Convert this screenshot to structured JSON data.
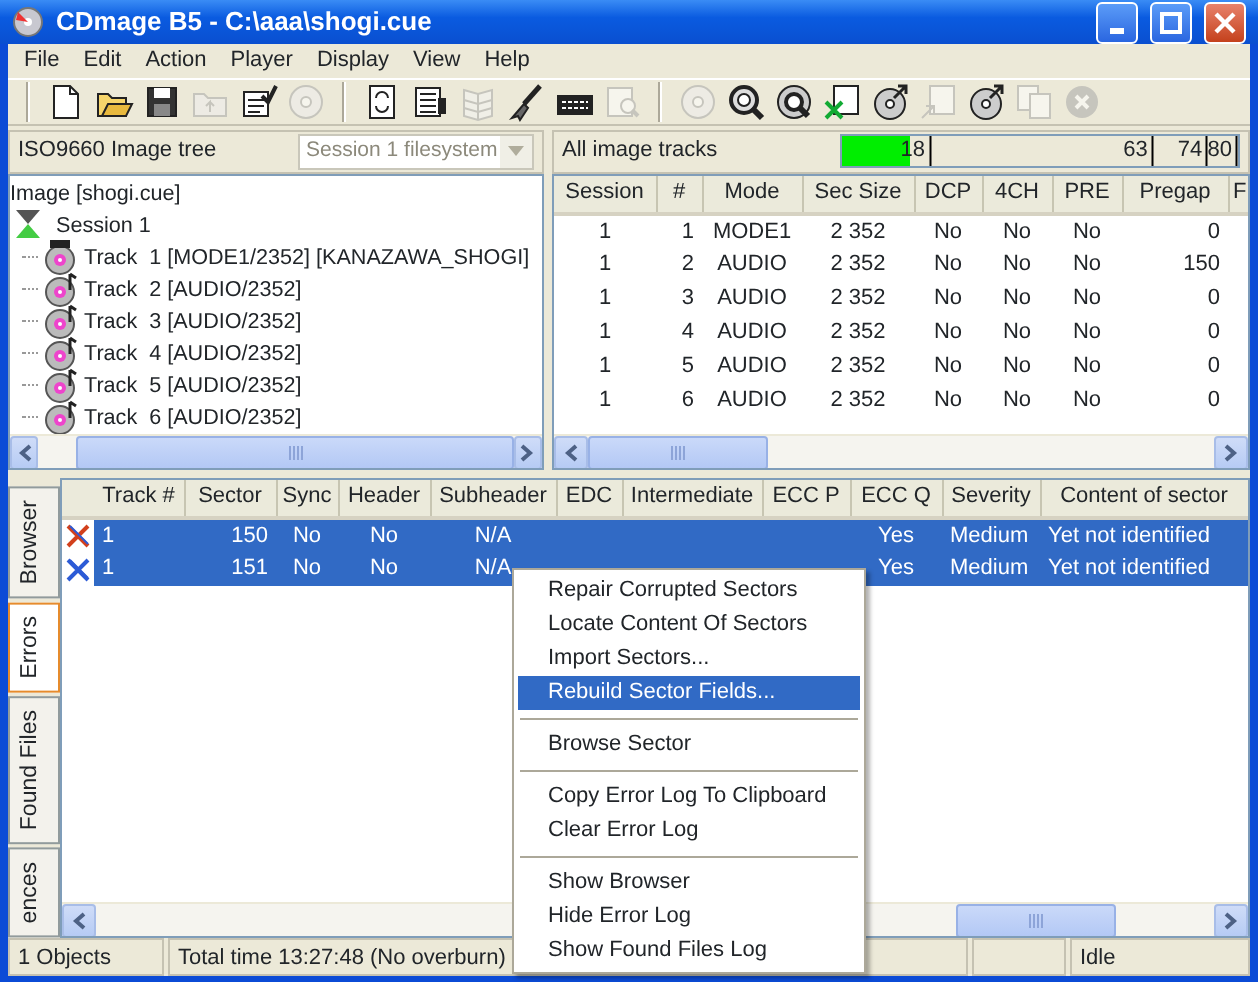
{
  "window": {
    "title": "CDmage B5 - C:\\aaa\\shogi.cue"
  },
  "menu": [
    "File",
    "Edit",
    "Action",
    "Player",
    "Display",
    "View",
    "Help"
  ],
  "toolbar": [
    [
      {
        "kind": "new-file",
        "disabled": false
      },
      {
        "kind": "open-folder",
        "disabled": false
      },
      {
        "kind": "save",
        "disabled": false
      },
      {
        "kind": "folder-up",
        "disabled": true
      },
      {
        "kind": "properties",
        "disabled": false
      },
      {
        "kind": "disc",
        "disabled": true
      }
    ],
    [
      {
        "kind": "refresh",
        "disabled": false
      },
      {
        "kind": "list",
        "disabled": false
      },
      {
        "kind": "grid",
        "disabled": true
      },
      {
        "kind": "brush",
        "disabled": false
      },
      {
        "kind": "keyboard",
        "disabled": false
      },
      {
        "kind": "document-search",
        "disabled": true
      }
    ],
    [
      {
        "kind": "disc",
        "disabled": true
      },
      {
        "kind": "search",
        "disabled": false
      },
      {
        "kind": "disc-search",
        "disabled": false
      },
      {
        "kind": "document-x",
        "disabled": false
      },
      {
        "kind": "disc-arrow",
        "disabled": false
      },
      {
        "kind": "document-arrow",
        "disabled": true
      },
      {
        "kind": "disc-arrow",
        "disabled": false
      },
      {
        "kind": "copy",
        "disabled": true
      },
      {
        "kind": "cancel",
        "disabled": true
      }
    ]
  ],
  "tree_panel": {
    "title": "ISO9660 Image tree",
    "filesystem_select": {
      "value": "Session 1 filesystem",
      "disabled": true
    },
    "tree": [
      {
        "label": "Image [shogi.cue]",
        "children": [
          {
            "label": "Session 1",
            "kind": "session",
            "children": [
              {
                "label": "Track  1 [MODE1/2352] [KANAZAWA_SHOGI]",
                "kind": "data-track"
              },
              {
                "label": "Track  2 [AUDIO/2352]",
                "kind": "audio-track"
              },
              {
                "label": "Track  3 [AUDIO/2352]",
                "kind": "audio-track"
              },
              {
                "label": "Track  4 [AUDIO/2352]",
                "kind": "audio-track"
              },
              {
                "label": "Track  5 [AUDIO/2352]",
                "kind": "audio-track"
              },
              {
                "label": "Track  6 [AUDIO/2352]",
                "kind": "audio-track"
              }
            ]
          }
        ]
      }
    ]
  },
  "tracks_panel": {
    "title": "All image tracks",
    "meter": {
      "level": 0.17,
      "marks": [
        "18",
        "63",
        "74",
        "80"
      ]
    },
    "columns": [
      "Session",
      "#",
      "Mode",
      "Sec Size",
      "DCP",
      "4CH",
      "PRE",
      "Pregap",
      "F"
    ],
    "rows": [
      [
        "1",
        "1",
        "MODE1",
        "2 352",
        "No",
        "No",
        "No",
        "0"
      ],
      [
        "1",
        "2",
        "AUDIO",
        "2 352",
        "No",
        "No",
        "No",
        "150"
      ],
      [
        "1",
        "3",
        "AUDIO",
        "2 352",
        "No",
        "No",
        "No",
        "0"
      ],
      [
        "1",
        "4",
        "AUDIO",
        "2 352",
        "No",
        "No",
        "No",
        "0"
      ],
      [
        "1",
        "5",
        "AUDIO",
        "2 352",
        "No",
        "No",
        "No",
        "0"
      ],
      [
        "1",
        "6",
        "AUDIO",
        "2 352",
        "No",
        "No",
        "No",
        "0"
      ]
    ]
  },
  "error_log": {
    "tabs": [
      {
        "label": "Browser",
        "selected": false
      },
      {
        "label": "Errors",
        "selected": true
      },
      {
        "label": "Found Files",
        "selected": false
      },
      {
        "label": "ences",
        "selected": false
      }
    ],
    "columns": [
      "Track #",
      "Sector",
      "Sync",
      "Header",
      "Subheader",
      "EDC",
      "Intermediate",
      "ECC P",
      "ECC Q",
      "Severity",
      "Content of sector"
    ],
    "rows": [
      {
        "selected": true,
        "cells": [
          "1",
          "150",
          "No",
          "No",
          "N/A",
          null,
          null,
          null,
          "Yes",
          "Medium",
          "Yet not identified"
        ]
      },
      {
        "selected": true,
        "cells": [
          "1",
          "151",
          "No",
          "No",
          "N/A",
          null,
          null,
          null,
          "Yes",
          "Medium",
          "Yet not identified"
        ]
      }
    ]
  },
  "status_bar": {
    "objects": "1 Objects",
    "time": "Total time 13:27:48 (No overburn)",
    "state": "Idle"
  },
  "context_menu": [
    {
      "kind": "item",
      "label": "Repair Corrupted Sectors",
      "selected": false
    },
    {
      "kind": "item",
      "label": "Locate Content Of Sectors",
      "selected": false
    },
    {
      "kind": "item",
      "label": "Import Sectors...",
      "selected": false
    },
    {
      "kind": "item",
      "label": "Rebuild Sector Fields...",
      "selected": true
    },
    {
      "kind": "separator"
    },
    {
      "kind": "item",
      "label": "Browse Sector",
      "selected": false
    },
    {
      "kind": "separator"
    },
    {
      "kind": "item",
      "label": "Copy Error Log To Clipboard",
      "selected": false
    },
    {
      "kind": "item",
      "label": "Clear Error Log",
      "selected": false
    },
    {
      "kind": "separator"
    },
    {
      "kind": "item",
      "label": "Show Browser",
      "selected": false
    },
    {
      "kind": "item",
      "label": "Hide Error Log",
      "selected": false
    },
    {
      "kind": "item",
      "label": "Show Found Files Log",
      "selected": false
    }
  ]
}
